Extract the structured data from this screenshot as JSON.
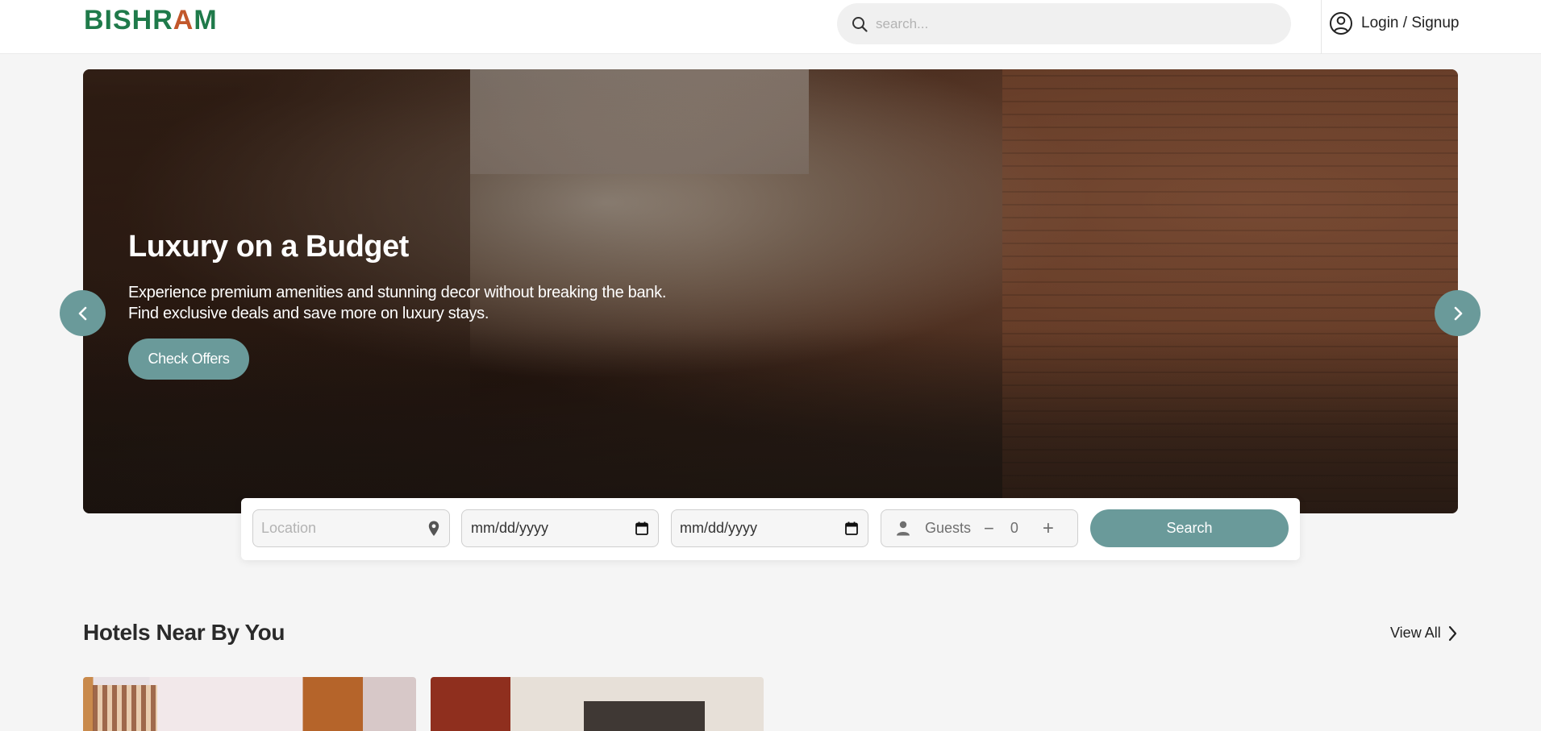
{
  "header": {
    "logo_pre": "BISHR",
    "logo_accent": "A",
    "logo_post": "M",
    "search_placeholder": "search...",
    "login_label": "Login / Signup"
  },
  "hero": {
    "title": "Luxury on a Budget",
    "subtitle_line1": "Experience premium amenities and stunning decor without breaking the bank.",
    "subtitle_line2": "Find exclusive deals and save more on luxury stays.",
    "cta_label": "Check Offers"
  },
  "booking": {
    "location_placeholder": "Location",
    "checkin_value": "mm/dd/yyyy",
    "checkout_value": "mm/dd/yyyy",
    "guests_label": "Guests",
    "guests_minus": "−",
    "guests_count": "0",
    "guests_plus": "+",
    "search_label": "Search"
  },
  "hotels": {
    "section_title": "Hotels Near By You",
    "view_all_label": "View All"
  },
  "colors": {
    "brand_green": "#1f7a4a",
    "brand_accent": "#c2572b",
    "button_teal": "#6a9a9a",
    "background": "#f5f5f5"
  }
}
